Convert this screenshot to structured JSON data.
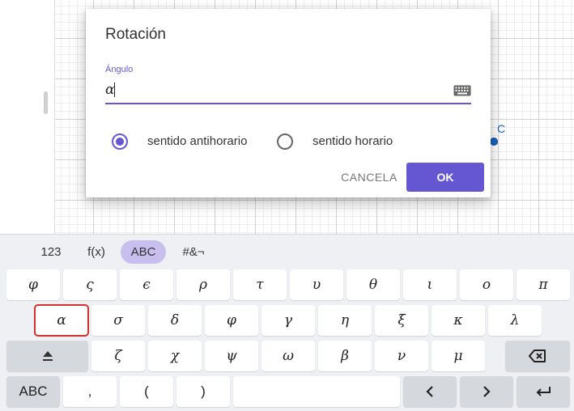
{
  "canvas": {
    "point_label": "C"
  },
  "dialog": {
    "title": "Rotación",
    "angle_label": "Ángulo",
    "angle_value": "α",
    "options": [
      {
        "label": "sentido antihorario",
        "checked": true
      },
      {
        "label": "sentido horario",
        "checked": false
      }
    ],
    "cancel_label": "CANCELA",
    "ok_label": "OK"
  },
  "keyboard": {
    "tabs": [
      {
        "label": "123",
        "active": false
      },
      {
        "label": "f(x)",
        "active": false
      },
      {
        "label": "ABC",
        "active": true
      },
      {
        "label": "#&¬",
        "active": false
      }
    ],
    "row1": [
      "φ",
      "ς",
      "ϵ",
      "ρ",
      "τ",
      "υ",
      "θ",
      "ι",
      "ο",
      "π"
    ],
    "row2": [
      "α",
      "σ",
      "δ",
      "φ",
      "γ",
      "η",
      "ξ",
      "κ",
      "λ"
    ],
    "row3": [
      "ζ",
      "χ",
      "ψ",
      "ω",
      "β",
      "ν",
      "μ"
    ],
    "row4": {
      "abc": "ABC",
      "comma": ",",
      "lparen": "(",
      "rparen": ")"
    },
    "icons": {
      "shift": "shift-icon",
      "backspace": "backspace-icon",
      "left": "arrow-left-icon",
      "right": "arrow-right-icon",
      "enter": "enter-icon",
      "keyboard": "keyboard-icon"
    },
    "highlighted_key": "α"
  },
  "colors": {
    "accent": "#6557d2",
    "tab_active": "#c8bfef",
    "point": "#1565c0",
    "highlight_border": "#d32f2f"
  }
}
